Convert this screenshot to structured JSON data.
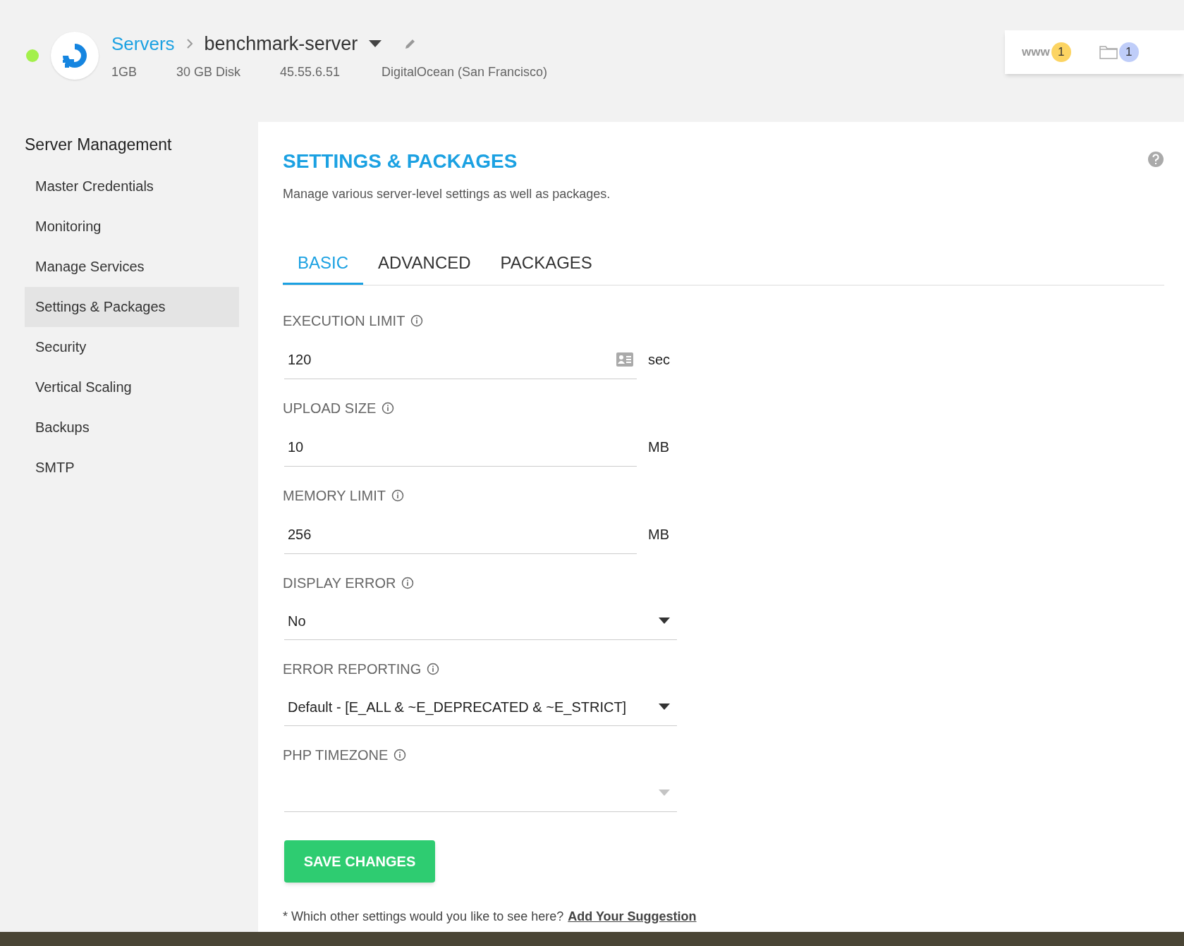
{
  "server": {
    "online": true,
    "breadcrumb_parent": "Servers",
    "name": "benchmark-server",
    "specs": [
      "1GB",
      "30 GB Disk",
      "45.55.6.51",
      "DigitalOcean (San Francisco)"
    ]
  },
  "counters": [
    {
      "kind": "www",
      "label": "www",
      "count": "1",
      "color": "#fcd462"
    },
    {
      "kind": "folder",
      "count": "1",
      "color": "#bfcdf9"
    }
  ],
  "sidebar": {
    "title": "Server Management",
    "items": [
      {
        "label": "Master Credentials",
        "selected": false
      },
      {
        "label": "Monitoring",
        "selected": false
      },
      {
        "label": "Manage Services",
        "selected": false
      },
      {
        "label": "Settings & Packages",
        "selected": true
      },
      {
        "label": "Security",
        "selected": false
      },
      {
        "label": "Vertical Scaling",
        "selected": false
      },
      {
        "label": "Backups",
        "selected": false
      },
      {
        "label": "SMTP",
        "selected": false
      }
    ]
  },
  "page": {
    "title": "SETTINGS & PACKAGES",
    "subtitle": "Manage various server-level settings as well as packages."
  },
  "tabs": [
    {
      "label": "BASIC",
      "selected": true
    },
    {
      "label": "ADVANCED",
      "selected": false
    },
    {
      "label": "PACKAGES",
      "selected": false
    }
  ],
  "fields": [
    {
      "kind": "input",
      "label": "EXECUTION LIMIT",
      "value": "120",
      "unit": "sec",
      "autofill_icon": true
    },
    {
      "kind": "input",
      "label": "UPLOAD SIZE",
      "value": "10",
      "unit": "MB",
      "autofill_icon": false
    },
    {
      "kind": "input",
      "label": "MEMORY LIMIT",
      "value": "256",
      "unit": "MB",
      "autofill_icon": false
    },
    {
      "kind": "select",
      "label": "DISPLAY ERROR",
      "value": "No"
    },
    {
      "kind": "select",
      "label": "ERROR REPORTING",
      "value": "Default - [E_ALL & ~E_DEPRECATED & ~E_STRICT]"
    },
    {
      "kind": "select",
      "label": "PHP TIMEZONE"
    }
  ],
  "save_button": "SAVE CHANGES",
  "footer": {
    "text": "* Which other settings would you like to see here?",
    "link": "Add Your Suggestion"
  }
}
